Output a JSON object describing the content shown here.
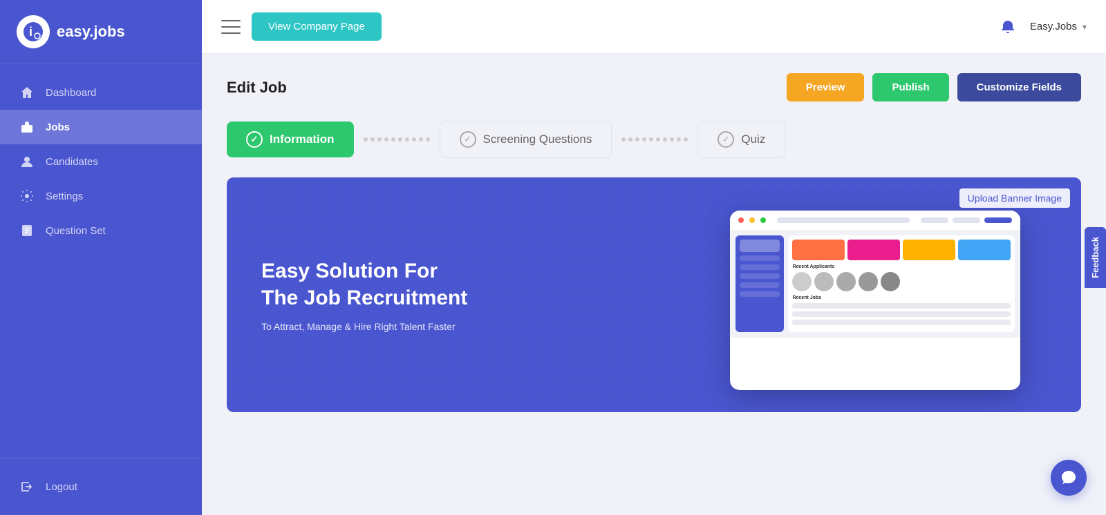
{
  "sidebar": {
    "logo_text": "easy.jobs",
    "items": [
      {
        "id": "dashboard",
        "label": "Dashboard",
        "active": false
      },
      {
        "id": "jobs",
        "label": "Jobs",
        "active": true
      },
      {
        "id": "candidates",
        "label": "Candidates",
        "active": false
      },
      {
        "id": "settings",
        "label": "Settings",
        "active": false
      },
      {
        "id": "question-set",
        "label": "Question Set",
        "active": false
      }
    ],
    "logout_label": "Logout"
  },
  "topbar": {
    "view_company_btn": "View Company Page",
    "user_name": "Easy.Jobs"
  },
  "page": {
    "title": "Edit Job",
    "buttons": {
      "preview": "Preview",
      "publish": "Publish",
      "customize": "Customize Fields"
    }
  },
  "steps": [
    {
      "id": "information",
      "label": "Information",
      "active": true
    },
    {
      "id": "screening",
      "label": "Screening Questions",
      "active": false
    },
    {
      "id": "quiz",
      "label": "Quiz",
      "active": false
    }
  ],
  "banner": {
    "headline_line1": "Easy Solution For",
    "headline_line2": "The Job Recruitment",
    "subtext": "To Attract, Manage & Hire Right Talent Faster",
    "upload_link": "Upload Banner Image"
  },
  "feedback": {
    "label": "Feedback"
  },
  "chat": {
    "icon": "💬"
  }
}
